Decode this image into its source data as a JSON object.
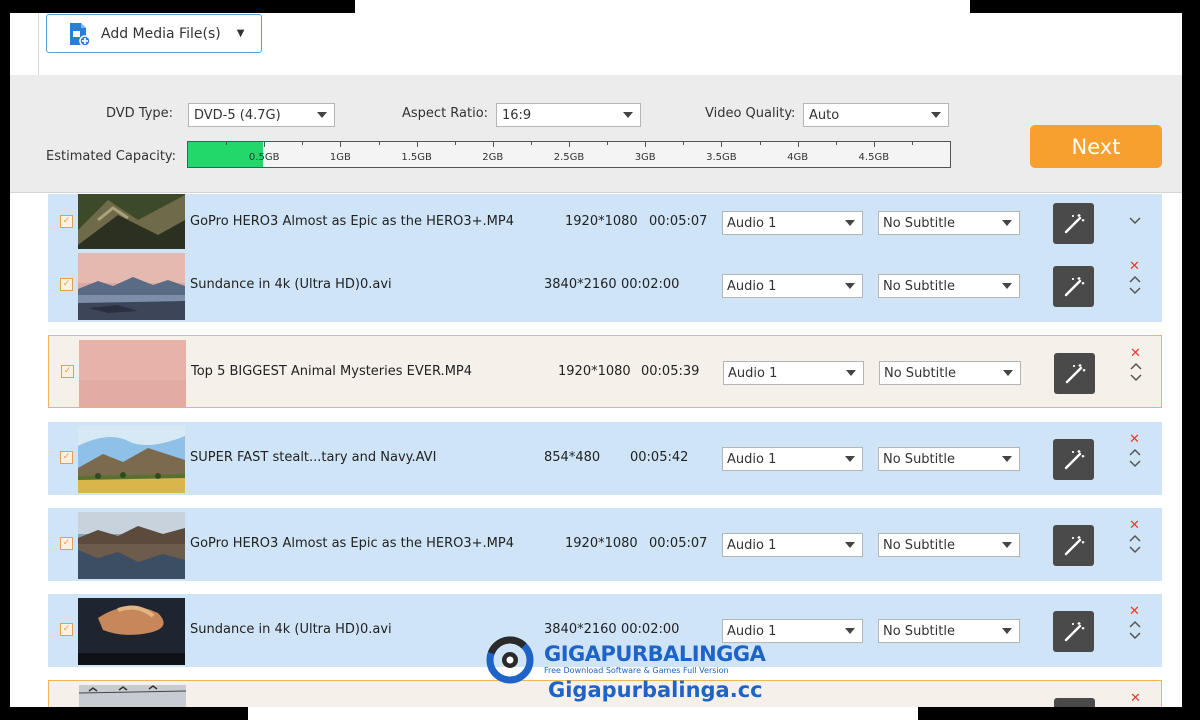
{
  "toolbar": {
    "add_media_label": "Add Media File(s)"
  },
  "settings": {
    "dvd_type_label": "DVD Type:",
    "dvd_type_value": "DVD-5 (4.7G)",
    "aspect_label": "Aspect Ratio:",
    "aspect_value": "16:9",
    "quality_label": "Video Quality:",
    "quality_value": "Auto",
    "capacity_label": "Estimated Capacity:",
    "capacity_used_gb": 0.5,
    "capacity_ticks": [
      "0.5GB",
      "1GB",
      "1.5GB",
      "2GB",
      "2.5GB",
      "3GB",
      "3.5GB",
      "4GB",
      "4.5GB"
    ]
  },
  "next_label": "Next",
  "files": [
    {
      "name": "GoPro HERO3 Almost as Epic as the HERO3+.MP4",
      "resolution": "1920*1080",
      "duration": "00:05:07",
      "audio": "Audio 1",
      "subtitle": "No Subtitle",
      "selected": false,
      "thumb": "cliffs"
    },
    {
      "name": "Sundance in 4k (Ultra HD)0.avi",
      "resolution": "3840*2160",
      "duration": "00:02:00",
      "audio": "Audio 1",
      "subtitle": "No Subtitle",
      "selected": false,
      "thumb": "lake-dusk"
    },
    {
      "name": "Top 5 BIGGEST Animal Mysteries EVER.MP4",
      "resolution": "1920*1080",
      "duration": "00:05:39",
      "audio": "Audio 1",
      "subtitle": "No Subtitle",
      "selected": true,
      "thumb": "pink"
    },
    {
      "name": "SUPER FAST stealt...tary and Navy.AVI",
      "resolution": "854*480",
      "duration": "00:05:42",
      "audio": "Audio 1",
      "subtitle": "No Subtitle",
      "selected": false,
      "thumb": "meadow"
    },
    {
      "name": "GoPro HERO3 Almost as Epic as the HERO3+.MP4",
      "resolution": "1920*1080",
      "duration": "00:05:07",
      "audio": "Audio 1",
      "subtitle": "No Subtitle",
      "selected": false,
      "thumb": "reflection"
    },
    {
      "name": "Sundance in 4k (Ultra HD)0.avi",
      "resolution": "3840*2160",
      "duration": "00:02:00",
      "audio": "Audio 1",
      "subtitle": "No Subtitle",
      "selected": false,
      "thumb": "storm"
    },
    {
      "name": "",
      "resolution": "",
      "duration": "",
      "audio": "",
      "subtitle": "",
      "selected": true,
      "thumb": "birds"
    }
  ],
  "watermark": {
    "title": "GIGAPURBALINGGA",
    "tagline": "Free Download Software & Games Full Version",
    "url": "Gigapurbalinga.cc"
  },
  "colors": {
    "accent": "#f7a030",
    "row_bg": "#cfe5f7",
    "capacity_fill": "#22d86a",
    "remove": "#e53a2a"
  }
}
